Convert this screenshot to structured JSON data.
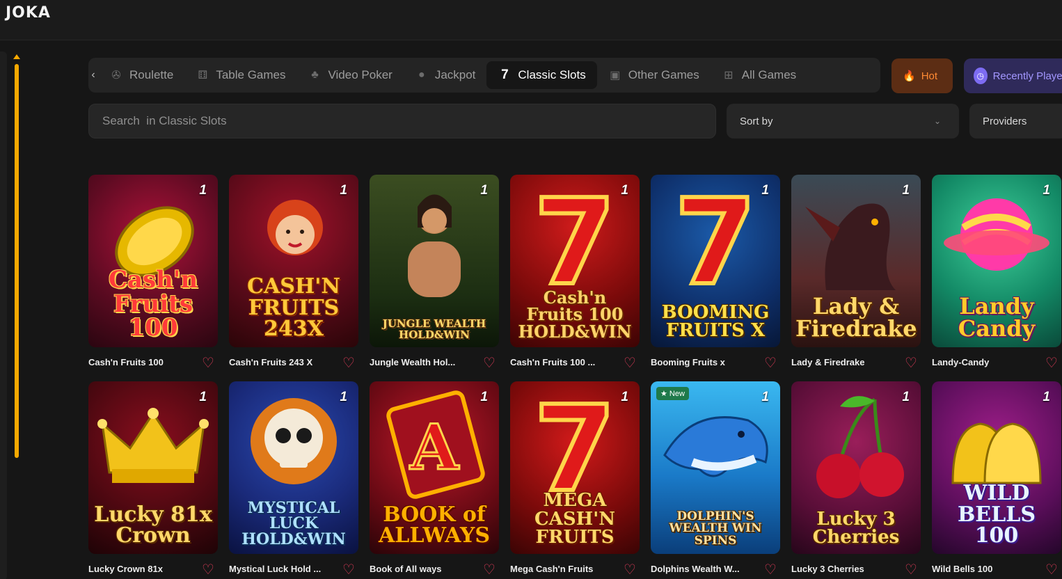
{
  "logo": "JOKA",
  "categories": [
    {
      "label": "Roulette",
      "icon": "roulette-icon"
    },
    {
      "label": "Table Games",
      "icon": "dice-icon"
    },
    {
      "label": "Video Poker",
      "icon": "club-icon"
    },
    {
      "label": "Jackpot",
      "icon": "jackpot-bag-icon"
    },
    {
      "label": "Classic Slots",
      "icon": "seven-icon"
    },
    {
      "label": "Other Games",
      "icon": "cards-icon"
    },
    {
      "label": "All Games",
      "icon": "grid-icon"
    }
  ],
  "active_category": "Classic Slots",
  "hot": {
    "label": "Hot",
    "icon": "flame-icon"
  },
  "recent": {
    "label": "Recently Played",
    "icon": "clock-icon"
  },
  "search": {
    "placeholder": "Search  in Classic Slots"
  },
  "sort": {
    "label": "Sort by"
  },
  "providers": {
    "label": "Providers"
  },
  "games": [
    {
      "name": "Cash'n Fruits 100",
      "art": "Cash'n Fruits 100",
      "num": "1",
      "badge": ""
    },
    {
      "name": "Cash'n Fruits 243 X",
      "art": "CASH'N FRUITS 243X",
      "num": "1",
      "badge": ""
    },
    {
      "name": "Jungle Wealth Hol...",
      "art": "JUNGLE WEALTH HOLD&WIN",
      "num": "1",
      "badge": ""
    },
    {
      "name": "Cash'n Fruits 100 ...",
      "art": "Cash'n Fruits 100 HOLD&WIN",
      "num": "1",
      "badge": ""
    },
    {
      "name": "Booming Fruits x",
      "art": "BOOMING FRUITS X",
      "num": "1",
      "badge": ""
    },
    {
      "name": "Lady & Firedrake",
      "art": "Lady & Firedrake",
      "num": "1",
      "badge": ""
    },
    {
      "name": "Landy-Candy",
      "art": "Landy Candy",
      "num": "1",
      "badge": ""
    },
    {
      "name": "Lucky Crown 81x",
      "art": "Lucky 81x Crown",
      "num": "1",
      "badge": ""
    },
    {
      "name": "Mystical Luck Hold ...",
      "art": "MYSTICAL LUCK HOLD&WIN",
      "num": "1",
      "badge": ""
    },
    {
      "name": "Book of All ways",
      "art": "BOOK of ALLWAYS",
      "num": "1",
      "badge": ""
    },
    {
      "name": "Mega Cash'n Fruits",
      "art": "MEGA CASH'N FRUITS",
      "num": "1",
      "badge": ""
    },
    {
      "name": "Dolphins Wealth W...",
      "art": "DOLPHIN'S WEALTH WIN SPINS",
      "num": "1",
      "badge": "New"
    },
    {
      "name": "Lucky 3 Cherries",
      "art": "Lucky 3 Cherries",
      "num": "1",
      "badge": ""
    },
    {
      "name": "Wild Bells 100",
      "art": "WILD BELLS 100",
      "num": "1",
      "badge": ""
    }
  ],
  "colors": {
    "accent": "#f7a900",
    "heart": "#e53c5a",
    "hot": "#ff8a33",
    "recent": "#a397ff"
  }
}
